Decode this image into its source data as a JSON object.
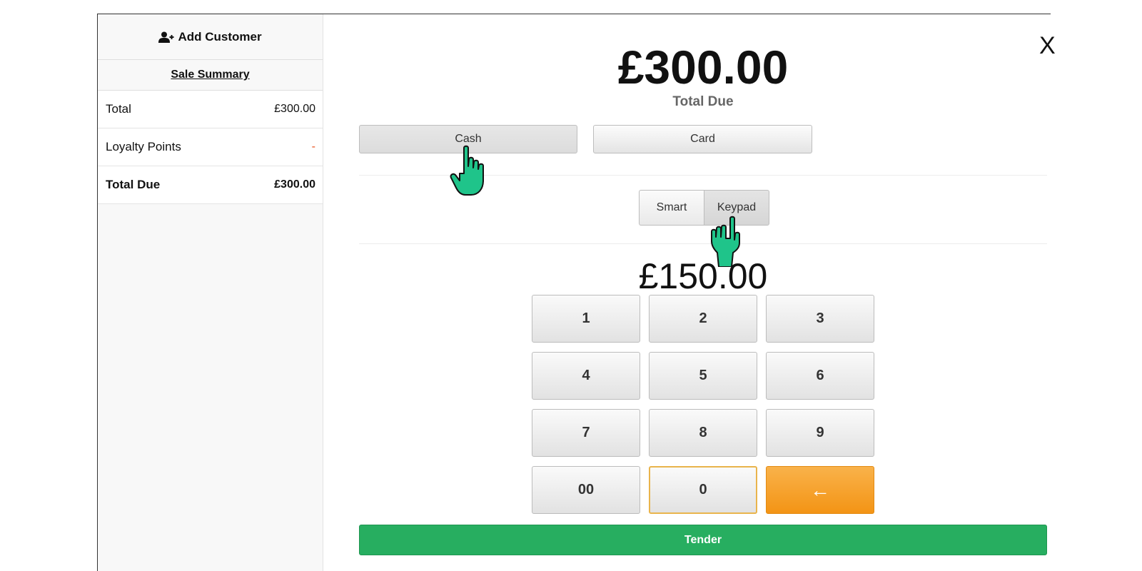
{
  "sidebar": {
    "add_customer_label": "Add Customer",
    "sale_summary_label": "Sale Summary",
    "rows": [
      {
        "label": "Total",
        "value": "£300.00"
      },
      {
        "label": "Loyalty Points",
        "value": "-"
      },
      {
        "label": "Total Due",
        "value": "£300.00"
      }
    ]
  },
  "main": {
    "close_label": "X",
    "amount": "£300.00",
    "amount_label": "Total Due",
    "payment_methods": [
      {
        "label": "Cash",
        "selected": true
      },
      {
        "label": "Card",
        "selected": false
      }
    ],
    "entry_modes": [
      {
        "label": "Smart",
        "selected": false
      },
      {
        "label": "Keypad",
        "selected": true
      }
    ],
    "entered_amount": "£150.00",
    "keypad": [
      "1",
      "2",
      "3",
      "4",
      "5",
      "6",
      "7",
      "8",
      "9",
      "00",
      "0",
      "←"
    ],
    "tender_label": "Tender"
  },
  "icons": {
    "add_customer": "user-plus-icon",
    "pointer": "hand-pointer-icon",
    "backspace": "left-arrow"
  },
  "colors": {
    "tender_green": "#27ae60",
    "backspace_orange": "#f39415",
    "pointer_green": "#1fc48a",
    "loyalty_dash": "#e8501c"
  }
}
